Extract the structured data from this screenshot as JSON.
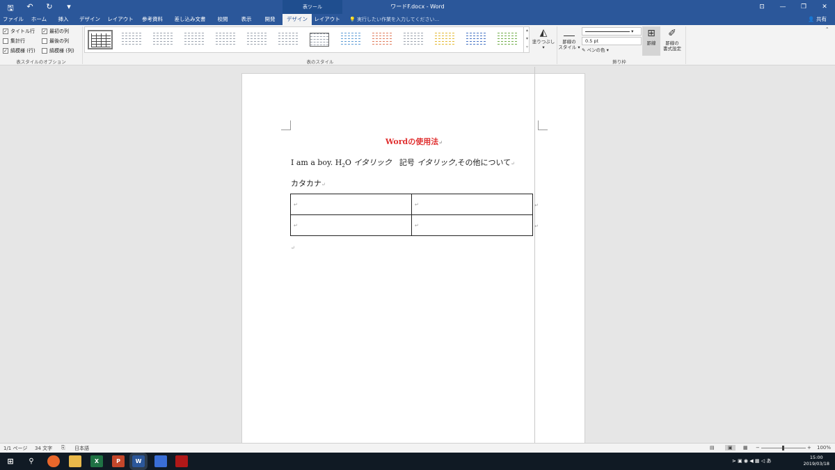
{
  "titlebar": {
    "qat": [
      "🖫",
      "↶",
      "↻",
      "▾"
    ],
    "context_tab_title": "表ツール",
    "document_title": "ワードF.docx - Word",
    "window_controls": [
      "⊡",
      "—",
      "❐",
      "✕"
    ]
  },
  "tabs": {
    "items": [
      "ファイル",
      "ホーム",
      "挿入",
      "デザイン",
      "レイアウト",
      "参考資料",
      "差し込み文書",
      "校閲",
      "表示",
      "開発",
      "デザイン",
      "レイアウト"
    ],
    "active_index": 10,
    "tellme": "実行したい作業を入力してください...",
    "share": "共有"
  },
  "ribbon": {
    "options": {
      "items": [
        {
          "label": "タイトル行",
          "checked": true
        },
        {
          "label": "最初の列",
          "checked": true
        },
        {
          "label": "集計行",
          "checked": false
        },
        {
          "label": "最後の列",
          "checked": false
        },
        {
          "label": "縞模様 (行)",
          "checked": true
        },
        {
          "label": "縞模様 (列)",
          "checked": false
        }
      ],
      "group_label": "表スタイルのオプション"
    },
    "styles_group_label": "表のスタイル",
    "shading_label": "塗りつぶし",
    "border_styles_label": "罫線の",
    "border_styles_label2": "スタイル ▾",
    "line_weight": "0.5 pt",
    "pen_color": "ペンの色 ▾",
    "borders_label": "罫線",
    "border_painter_label": "罫線の",
    "border_painter_label2": "書式設定",
    "borders_group_label": "飾り枠"
  },
  "document": {
    "heading": "Wordの使用法",
    "line1_a": "I am a boy. H",
    "line1_sub": "2",
    "line1_b": "O ",
    "line1_c": "イタリック",
    "line1_d": "　記号 ",
    "line1_e": "イタリック",
    "line1_f": ",その他について",
    "line2": "カタカナ",
    "para_mark": "↵"
  },
  "statusbar": {
    "page": "1/1 ページ",
    "words": "34 文字",
    "language": "日本語",
    "zoom": "100%"
  },
  "clock": {
    "time": "15:00",
    "date": "2019/03/18"
  }
}
